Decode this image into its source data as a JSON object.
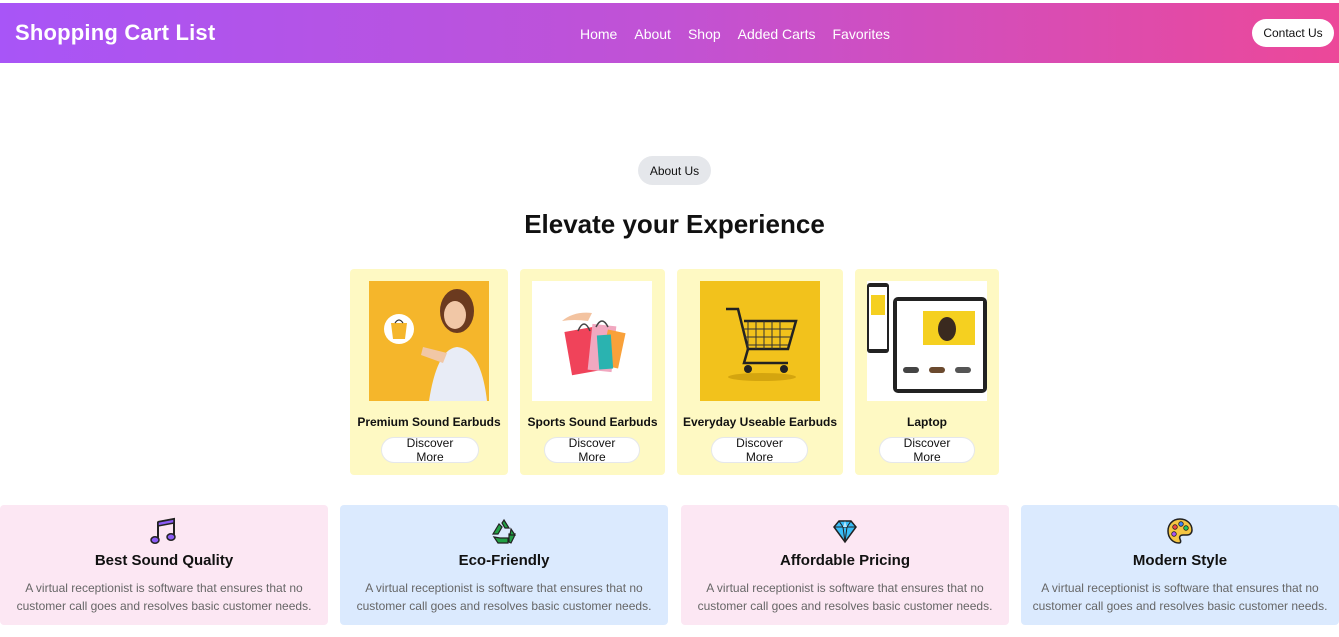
{
  "navbar": {
    "brand": "Shopping Cart List",
    "links": [
      "Home",
      "About",
      "Shop",
      "Added Carts",
      "Favorites"
    ],
    "contact_label": "Contact Us"
  },
  "hero": {
    "pill_label": "About Us",
    "title": "Elevate your Experience"
  },
  "products": [
    {
      "name": "Premium Sound Earbuds",
      "button": "Discover More",
      "image": "woman-pointing-photo"
    },
    {
      "name": "Sports Sound Earbuds",
      "button": "Discover More",
      "image": "shopping-bags-photo"
    },
    {
      "name": "Everyday Useable Earbuds",
      "button": "Discover More",
      "image": "shopping-cart-photo"
    },
    {
      "name": "Laptop",
      "button": "Discover More",
      "image": "devices-mockup-photo"
    }
  ],
  "features": [
    {
      "icon": "music-note-icon",
      "title": "Best Sound Quality",
      "desc": "A virtual receptionist is software that ensures that no customer call goes and resolves basic customer needs.",
      "color": "#fce7f3"
    },
    {
      "icon": "recycle-icon",
      "title": "Eco-Friendly",
      "desc": "A virtual receptionist is software that ensures that no customer call goes and resolves basic customer needs.",
      "color": "#dbeafe"
    },
    {
      "icon": "diamond-icon",
      "title": "Affordable Pricing",
      "desc": "A virtual receptionist is software that ensures that no customer call goes and resolves basic customer needs.",
      "color": "#fce7f3"
    },
    {
      "icon": "palette-icon",
      "title": "Modern Style",
      "desc": "A virtual receptionist is software that ensures that no customer call goes and resolves basic customer needs.",
      "color": "#dbeafe"
    }
  ],
  "colors": {
    "gradient_start": "#a855f7",
    "gradient_end": "#ec4899",
    "product_card": "#fef9c3",
    "feature_pink": "#fce7f3",
    "feature_blue": "#dbeafe"
  }
}
